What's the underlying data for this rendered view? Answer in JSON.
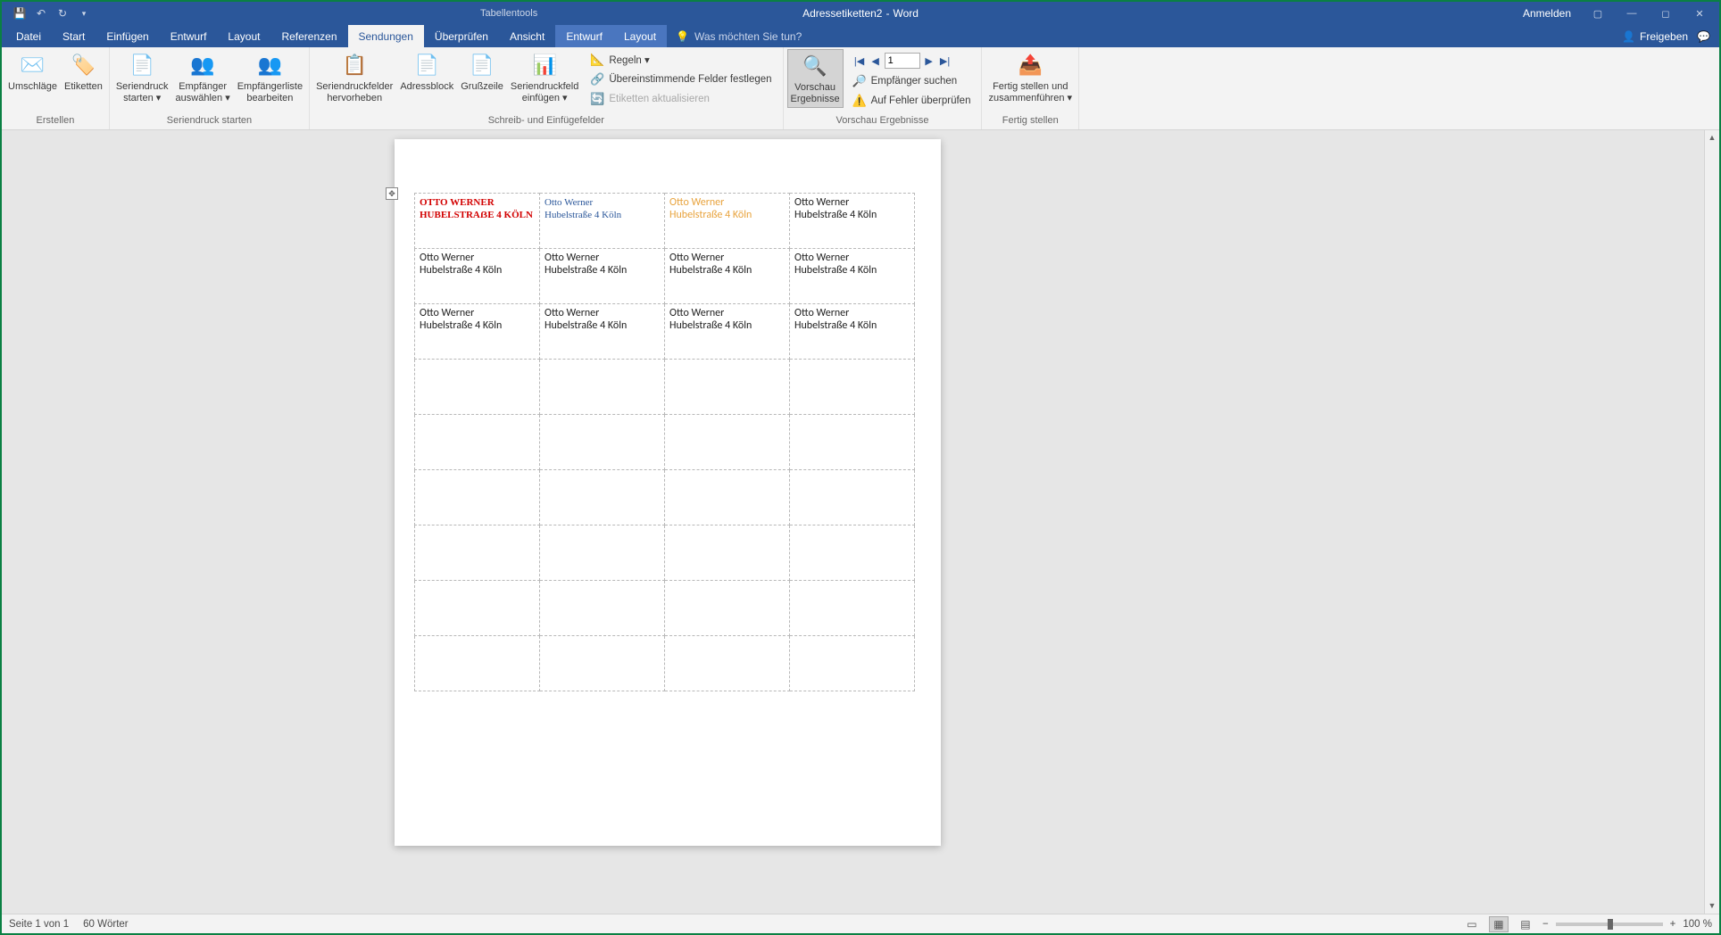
{
  "title": {
    "doc": "Adressetiketten2",
    "app": "Word",
    "contextTools": "Tabellentools"
  },
  "titleRight": {
    "signin": "Anmelden"
  },
  "tabs": {
    "file": "Datei",
    "home": "Start",
    "insert": "Einfügen",
    "design": "Entwurf",
    "layout": "Layout",
    "references": "Referenzen",
    "mailings": "Sendungen",
    "review": "Überprüfen",
    "view": "Ansicht",
    "tableDesign": "Entwurf",
    "tableLayout": "Layout",
    "tellMe": "Was möchten Sie tun?",
    "share": "Freigeben"
  },
  "ribbon": {
    "create": {
      "label": "Erstellen",
      "envelopes": "Umschläge",
      "labels": "Etiketten"
    },
    "start": {
      "label": "Seriendruck starten",
      "startMerge": "Seriendruck\nstarten ▾",
      "select": "Empfänger\nauswählen ▾",
      "edit": "Empfängerliste\nbearbeiten"
    },
    "write": {
      "label": "Schreib- und Einfügefelder",
      "highlight": "Seriendruckfelder\nhervorheben",
      "address": "Adressblock",
      "greeting": "Grußzeile",
      "insert": "Seriendruckfeld\neinfügen ▾",
      "rules": "Regeln ▾",
      "match": "Übereinstimmende Felder festlegen",
      "update": "Etiketten aktualisieren"
    },
    "preview": {
      "label": "Vorschau Ergebnisse",
      "btn": "Vorschau\nErgebnisse",
      "record": "1",
      "find": "Empfänger suchen",
      "check": "Auf Fehler überprüfen"
    },
    "finish": {
      "label": "Fertig stellen",
      "btn": "Fertig stellen und\nzusammenführen ▾"
    }
  },
  "labelsData": {
    "name": "Otto Werner",
    "addr": "Hubelstraße 4 Köln",
    "redName": "OTTO WERNER",
    "redAddr": "HUBELSTRAẞE 4 KÖLN"
  },
  "status": {
    "page": "Seite 1 von 1",
    "words": "60 Wörter",
    "zoom": "100 %"
  }
}
